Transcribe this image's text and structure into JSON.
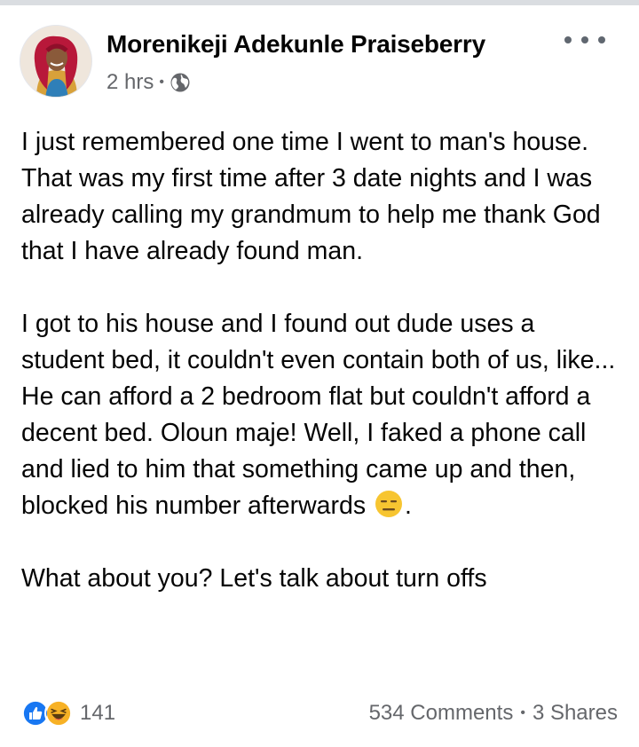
{
  "post": {
    "author": "Morenikeji Adekunle Praiseberry",
    "time": "2 hrs",
    "privacy_icon": "globe-icon",
    "paragraphs": [
      "I just remembered one time I went to man's house. That was my first time after 3 date nights and I was already calling my grandmum to help me thank God that I have already found man.",
      "I got to his house and I found out dude uses a student bed, it couldn't even contain both of us, like... He can afford a 2 bedroom flat but couldn't afford a decent bed. Oloun maje! Well, I faked a phone call and lied to him that something came up and then, blocked his number afterwards",
      "What about you? Let's talk about turn offs"
    ],
    "paragraph2_trailing_emoji": "expressionless-face-emoji",
    "paragraph2_end": "."
  },
  "reactions": {
    "icons": [
      "like-icon",
      "haha-icon"
    ],
    "count": "141"
  },
  "stats": {
    "comments": "534 Comments",
    "shares": "3 Shares"
  },
  "colors": {
    "text": "#050505",
    "secondary": "#65676b",
    "like_blue": "#1877f2",
    "haha_yellow": "#f7b125"
  }
}
